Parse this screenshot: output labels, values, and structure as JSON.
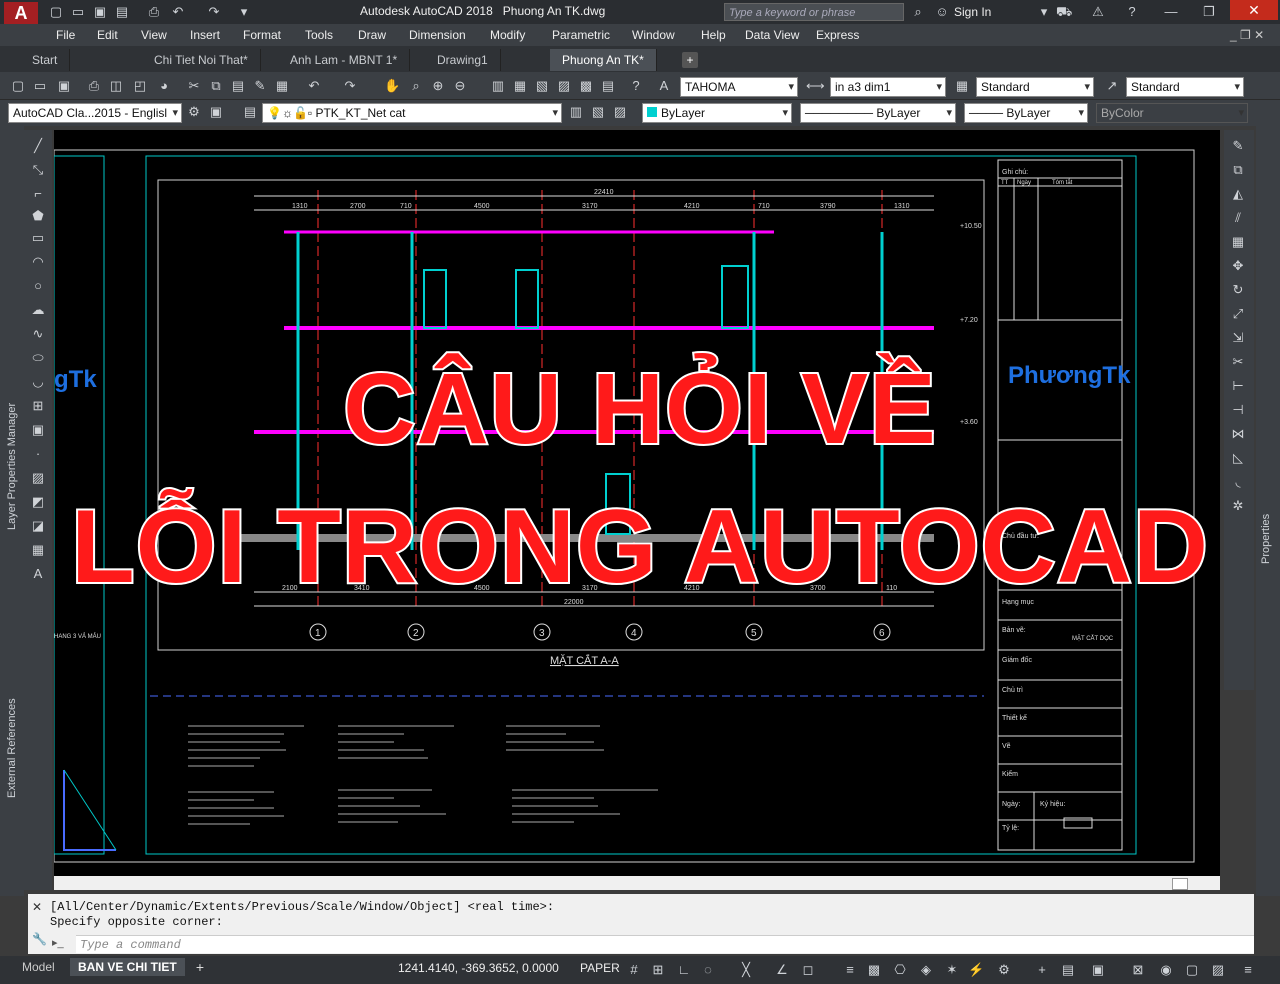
{
  "app": {
    "title": "Autodesk AutoCAD 2018",
    "file": "Phuong An TK.dwg",
    "logo": "A",
    "search_placeholder": "Type a keyword or phrase",
    "sign_in": "Sign In"
  },
  "menu": [
    "File",
    "Edit",
    "View",
    "Insert",
    "Format",
    "Tools",
    "Draw",
    "Dimension",
    "Modify",
    "Parametric",
    "Window",
    "Help",
    "Data View",
    "Express"
  ],
  "tabs": [
    "Start",
    "Chi Tiet Noi That*",
    "Anh Lam - MBNT 1*",
    "Drawing1",
    "Phuong An TK*"
  ],
  "active_tab": "Phuong An TK*",
  "toolbar": {
    "text_style": "TAHOMA",
    "dim_style": "in a3 dim1",
    "table_style": "Standard",
    "mleader_style": "Standard",
    "workspace": "AutoCAD Cla...2015 - Englisl",
    "layer": "PTK_KT_Net cat",
    "color": "ByLayer",
    "linetype": "ByLayer",
    "lineweight": "ByLayer",
    "plotstyle": "ByColor"
  },
  "palettes": {
    "left_top": "Layer Properties Manager",
    "left_bottom": "External References",
    "right": "Properties"
  },
  "drawing": {
    "section_title": "MẶT CẮT A-A",
    "brand": "PhươngTk",
    "brand_left": "gTk",
    "notes_header": "Ghi chú:",
    "notes_cols": [
      "TT",
      "Ngày",
      "Tóm tắt"
    ],
    "title_block": [
      "Chủ đầu tư:",
      "Hạng mục",
      "Bản vẽ:",
      "Giám đốc",
      "Chủ trì",
      "Thiết kế",
      "Vẽ",
      "Kiểm",
      "Ngày:",
      "Tỷ lệ:"
    ],
    "drawing_name": "MẶT CẮT DỌC",
    "sign_label": "Ký hiệu:",
    "total_dim_top": "22410",
    "total_dim_bottom": "22000",
    "dims_top": [
      "1310",
      "2700",
      "710",
      "4500",
      "3170",
      "4210",
      "710",
      "3790",
      "1310"
    ],
    "dims_bottom": [
      "2100",
      "3410",
      "4500",
      "3170",
      "4210",
      "3700",
      "110"
    ],
    "grid_labels": [
      "1",
      "2",
      "3",
      "4",
      "5",
      "6"
    ],
    "levels": [
      "+10.50",
      "+7.20",
      "+3.60"
    ],
    "legend_left_label": "HANG 3 VẢ MẢU"
  },
  "overlay": {
    "line1": "CÂU HỎI VỀ",
    "line2": "LỖI TRONG AUTOCAD"
  },
  "command": {
    "history1": "[All/Center/Dynamic/Extents/Previous/Scale/Window/Object] <real time>:",
    "history2": "Specify opposite corner:",
    "placeholder": "Type a command"
  },
  "status": {
    "layout_tabs": [
      "Model",
      "BAN VE CHI TIET"
    ],
    "active_layout": "BAN VE CHI TIET",
    "coords": "1241.4140, -369.3652, 0.0000",
    "space": "PAPER"
  },
  "colors": {
    "overlay_text": "#ff1a1a",
    "brand": "#1e6fe0",
    "magenta_line": "#ff00ff",
    "cyan_line": "#00d0d0"
  }
}
